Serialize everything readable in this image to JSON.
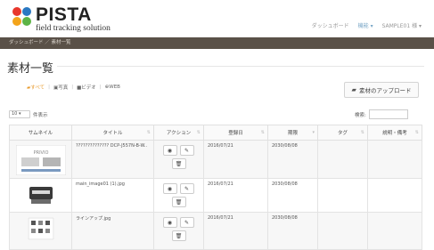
{
  "header": {
    "logo_title": "PISTA",
    "logo_subtitle": "field tracking solution",
    "nav": [
      "ダッシュボード",
      "機能 ▾",
      "SAMPLE01 様 ▾"
    ]
  },
  "breadcrumb": "ダッシュボード ／ 素材一覧",
  "page_title": "素材一覧",
  "filters": [
    {
      "label": "すべて",
      "icon": "folder-icon"
    },
    {
      "label": "写真",
      "icon": "photo-icon"
    },
    {
      "label": "ビデオ",
      "icon": "video-icon"
    },
    {
      "label": "WEB",
      "icon": "globe-icon"
    }
  ],
  "upload_button": "素材のアップロード",
  "page_size": {
    "value": "10",
    "suffix": "件表示"
  },
  "search_label": "検索:",
  "table": {
    "columns": [
      "サムネイル",
      "タイトル",
      "アクション",
      "登録日",
      "期限",
      "タグ",
      "説明・備考"
    ],
    "rows": [
      {
        "title": "?????????????? DCP-J557N-B-W..",
        "registered": "2016/07/21",
        "deadline": "2030/08/08",
        "tag": "",
        "note": ""
      },
      {
        "title": "main_image01 (1).jpg",
        "registered": "2016/07/21",
        "deadline": "2030/08/08",
        "tag": "",
        "note": ""
      },
      {
        "title": "ラインアップ.jpg",
        "registered": "2016/07/21",
        "deadline": "2030/08/08",
        "tag": "",
        "note": ""
      }
    ]
  },
  "colors": {
    "breadcrumb_bg": "#5a5148",
    "accent": "#e89b2e"
  }
}
